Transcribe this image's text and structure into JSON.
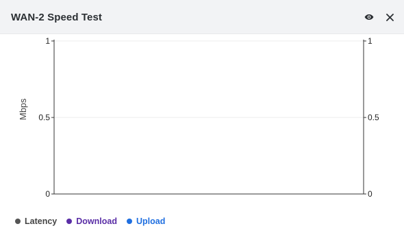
{
  "widget": {
    "title": "WAN-2 Speed Test",
    "view_icon": "eye-icon",
    "close_icon": "close-icon"
  },
  "chart_data": {
    "type": "line",
    "ylabel": "Mbps",
    "ylim": [
      0,
      1
    ],
    "y_ticks_left": [
      "1",
      "0.5",
      "0"
    ],
    "y_ticks_right": [
      "1",
      "0.5",
      "0"
    ],
    "grid": true,
    "series": [
      {
        "name": "Latency",
        "color": "#555555",
        "values": []
      },
      {
        "name": "Download",
        "color": "#5a2ea6",
        "values": []
      },
      {
        "name": "Upload",
        "color": "#1f6fe0",
        "values": []
      }
    ],
    "legend_position": "bottom-left"
  }
}
